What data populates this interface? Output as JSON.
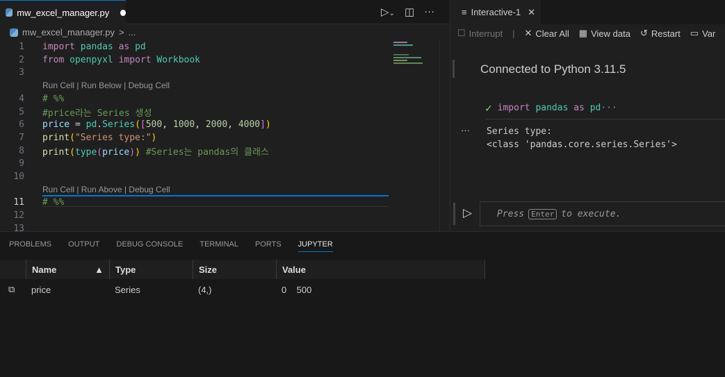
{
  "editor": {
    "tab_label": "mw_excel_manager.py",
    "breadcrumb": {
      "file": "mw_excel_manager.py",
      "sep": ">",
      "rest": "..."
    },
    "lenses": [
      "Run Cell | Run Below | Debug Cell",
      "Run Cell | Run Above | Debug Cell"
    ],
    "lines": [
      {
        "n": "1",
        "tokens": [
          [
            "kw",
            "import"
          ],
          [
            "op",
            " "
          ],
          [
            "mod",
            "pandas"
          ],
          [
            "op",
            " "
          ],
          [
            "kw",
            "as"
          ],
          [
            "op",
            " "
          ],
          [
            "mod",
            "pd"
          ]
        ]
      },
      {
        "n": "2",
        "tokens": [
          [
            "kw",
            "from"
          ],
          [
            "op",
            " "
          ],
          [
            "mod",
            "openpyxl"
          ],
          [
            "op",
            " "
          ],
          [
            "kw",
            "import"
          ],
          [
            "op",
            " "
          ],
          [
            "mod",
            "Workbook"
          ]
        ]
      },
      {
        "n": "3",
        "tokens": []
      },
      {
        "n": "4",
        "tokens": [
          [
            "cm",
            "# %%"
          ]
        ]
      },
      {
        "n": "5",
        "tokens": [
          [
            "cm",
            "#price라는 Series 생성"
          ]
        ]
      },
      {
        "n": "6",
        "tokens": [
          [
            "var",
            "price"
          ],
          [
            "op",
            " = "
          ],
          [
            "mod",
            "pd"
          ],
          [
            "op",
            "."
          ],
          [
            "mod",
            "Series"
          ],
          [
            "b1",
            "("
          ],
          [
            "b2",
            "["
          ],
          [
            "num",
            "500"
          ],
          [
            "op",
            ", "
          ],
          [
            "num",
            "1000"
          ],
          [
            "op",
            ", "
          ],
          [
            "num",
            "2000"
          ],
          [
            "op",
            ", "
          ],
          [
            "num",
            "4000"
          ],
          [
            "b2",
            "]"
          ],
          [
            "b1",
            ")"
          ]
        ]
      },
      {
        "n": "7",
        "tokens": [
          [
            "fn",
            "print"
          ],
          [
            "b1",
            "("
          ],
          [
            "str",
            "\"Series type:\""
          ],
          [
            "b1",
            ")"
          ]
        ]
      },
      {
        "n": "8",
        "tokens": [
          [
            "fn",
            "print"
          ],
          [
            "b1",
            "("
          ],
          [
            "mod",
            "type"
          ],
          [
            "b2",
            "("
          ],
          [
            "var",
            "price"
          ],
          [
            "b2",
            ")"
          ],
          [
            "b1",
            ")"
          ],
          [
            "op",
            " "
          ],
          [
            "cm",
            "#Series는 pandas의 클래스"
          ]
        ]
      },
      {
        "n": "9",
        "tokens": []
      },
      {
        "n": "10",
        "tokens": []
      },
      {
        "n": "11",
        "tokens": [
          [
            "cm",
            "# %%"
          ]
        ]
      },
      {
        "n": "12",
        "tokens": []
      },
      {
        "n": "13",
        "tokens": []
      }
    ]
  },
  "interactive": {
    "tab_label": "Interactive-1",
    "toolbar": {
      "interrupt": "Interrupt",
      "clear_all": "Clear All",
      "view_data": "View data",
      "restart": "Restart",
      "variables": "Var"
    },
    "connected": "Connected to Python 3.11.5",
    "cell_summary": {
      "kw1": "import",
      "mod1": "pandas",
      "kw2": "as",
      "mod2": "pd",
      "more": "···"
    },
    "output": [
      "Series type:",
      "<class 'pandas.core.series.Series'>"
    ],
    "output_more": "···",
    "input": {
      "press": "Press",
      "key": "Enter",
      "rest": "to execute."
    }
  },
  "panel": {
    "tabs": [
      "PROBLEMS",
      "OUTPUT",
      "DEBUG CONSOLE",
      "TERMINAL",
      "PORTS",
      "JUPYTER"
    ],
    "active_tab": "JUPYTER",
    "columns": [
      "Name",
      "Type",
      "Size",
      "Value"
    ],
    "rows": [
      {
        "name": "price",
        "type": "Series",
        "size": "(4,)",
        "value": "0    500"
      }
    ]
  }
}
